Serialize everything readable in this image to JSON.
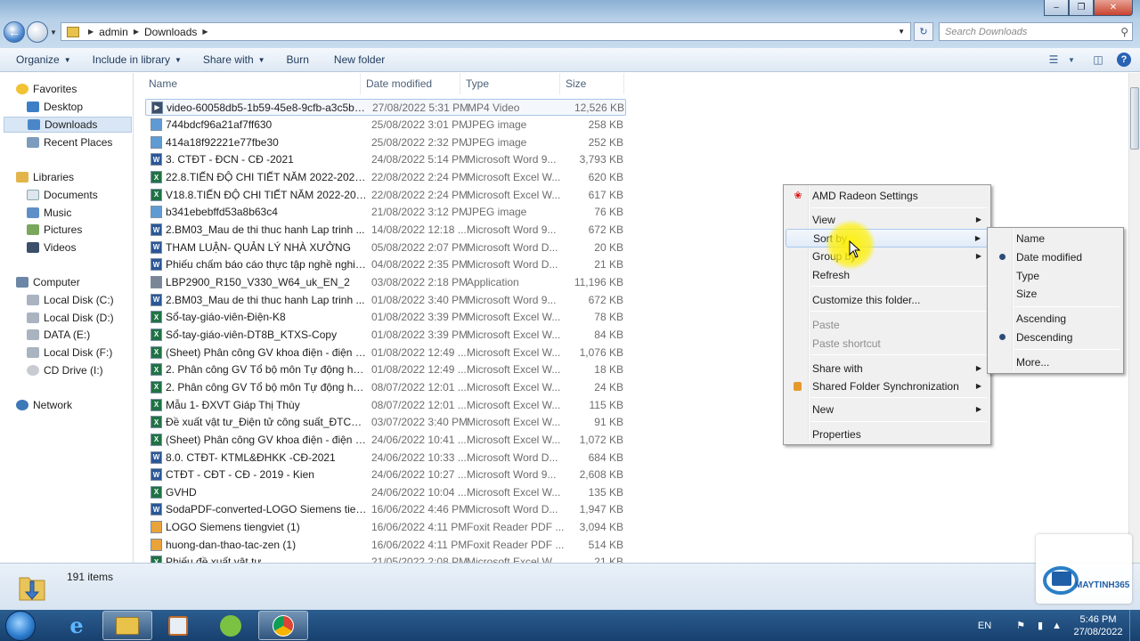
{
  "address": {
    "crumbs": [
      "admin",
      "Downloads"
    ]
  },
  "search": {
    "placeholder": "Search Downloads"
  },
  "toolbar": {
    "organize": "Organize",
    "include_in_library": "Include in library",
    "share_with": "Share with",
    "burn": "Burn",
    "new_folder": "New folder"
  },
  "nav": {
    "favorites": "Favorites",
    "desktop": "Desktop",
    "downloads": "Downloads",
    "recent_places": "Recent Places",
    "libraries": "Libraries",
    "documents": "Documents",
    "music": "Music",
    "pictures": "Pictures",
    "videos": "Videos",
    "computer": "Computer",
    "local_c": "Local Disk (C:)",
    "local_d": "Local Disk (D:)",
    "data_e": "DATA (E:)",
    "local_f": "Local Disk (F:)",
    "cd_i": "CD Drive (I:)",
    "network": "Network"
  },
  "columns": {
    "name": "Name",
    "date": "Date modified",
    "type": "Type",
    "size": "Size"
  },
  "files": [
    {
      "name": "video-60058db5-1b59-45e8-9cfb-a3c5b0...",
      "date": "27/08/2022 5:31 PM",
      "type": "MP4 Video",
      "size": "12,526 KB",
      "icon": "video"
    },
    {
      "name": "744bdcf96a21af7ff630",
      "date": "25/08/2022 3:01 PM",
      "type": "JPEG image",
      "size": "258 KB",
      "icon": "image"
    },
    {
      "name": "414a18f92221e77fbe30",
      "date": "25/08/2022 2:32 PM",
      "type": "JPEG image",
      "size": "252 KB",
      "icon": "image"
    },
    {
      "name": "3. CTĐT - ĐCN - CĐ -2021",
      "date": "24/08/2022 5:14 PM",
      "type": "Microsoft Word 9...",
      "size": "3,793 KB",
      "icon": "word"
    },
    {
      "name": "22.8.TIẾN ĐỘ CHI TIẾT NĂM 2022-2023 V...",
      "date": "22/08/2022 2:24 PM",
      "type": "Microsoft Excel W...",
      "size": "620 KB",
      "icon": "excel"
    },
    {
      "name": "V18.8.TIẾN ĐỘ CHI TIẾT NĂM 2022-2023 ...",
      "date": "22/08/2022 2:24 PM",
      "type": "Microsoft Excel W...",
      "size": "617 KB",
      "icon": "excel"
    },
    {
      "name": "b341ebebffd53a8b63c4",
      "date": "21/08/2022 3:12 PM",
      "type": "JPEG image",
      "size": "76 KB",
      "icon": "image"
    },
    {
      "name": "2.BM03_Mau de thi thuc hanh Lap trinh ...",
      "date": "14/08/2022 12:18 ...",
      "type": "Microsoft Word 9...",
      "size": "672 KB",
      "icon": "word"
    },
    {
      "name": "THAM LUẬN- QUẢN LÝ NHÀ XƯỞNG",
      "date": "05/08/2022 2:07 PM",
      "type": "Microsoft Word D...",
      "size": "20 KB",
      "icon": "word"
    },
    {
      "name": "Phiếu chấm báo cáo thực tập nghề nghiệp",
      "date": "04/08/2022 2:35 PM",
      "type": "Microsoft Word D...",
      "size": "21 KB",
      "icon": "word"
    },
    {
      "name": "LBP2900_R150_V330_W64_uk_EN_2",
      "date": "03/08/2022 2:18 PM",
      "type": "Application",
      "size": "11,196 KB",
      "icon": "app"
    },
    {
      "name": "2.BM03_Mau de thi thuc hanh Lap trinh ...",
      "date": "01/08/2022 3:40 PM",
      "type": "Microsoft Word 9...",
      "size": "672 KB",
      "icon": "word"
    },
    {
      "name": "Sổ-tay-giáo-viên-Điện-K8",
      "date": "01/08/2022 3:39 PM",
      "type": "Microsoft Excel W...",
      "size": "78 KB",
      "icon": "excel"
    },
    {
      "name": "Sổ-tay-giáo-viên-DT8B_KTXS-Copy",
      "date": "01/08/2022 3:39 PM",
      "type": "Microsoft Excel W...",
      "size": "84 KB",
      "icon": "excel"
    },
    {
      "name": "(Sheet) Phân công GV khoa điện - điện t...",
      "date": "01/08/2022 12:49 ...",
      "type": "Microsoft Excel W...",
      "size": "1,076 KB",
      "icon": "excel"
    },
    {
      "name": "2. Phân công GV Tổ bộ môn Tự động ho...",
      "date": "01/08/2022 12:49 ...",
      "type": "Microsoft Excel W...",
      "size": "18 KB",
      "icon": "excel"
    },
    {
      "name": "2. Phân công GV Tổ bộ môn Tự động ho...",
      "date": "08/07/2022 12:01 ...",
      "type": "Microsoft Excel W...",
      "size": "24 KB",
      "icon": "excel"
    },
    {
      "name": "Mẫu 1- ĐXVT Giáp Thị Thùy",
      "date": "08/07/2022 12:01 ...",
      "type": "Microsoft Excel W...",
      "size": "115 KB",
      "icon": "excel"
    },
    {
      "name": "Đề xuất vật tư_Điện tử công suất_ĐTCN_...",
      "date": "03/07/2022 3:40 PM",
      "type": "Microsoft Excel W...",
      "size": "91 KB",
      "icon": "excel"
    },
    {
      "name": "(Sheet) Phân công GV khoa điện - điện t...",
      "date": "24/06/2022 10:41 ...",
      "type": "Microsoft Excel W...",
      "size": "1,072 KB",
      "icon": "excel"
    },
    {
      "name": "8.0. CTĐT- KTML&ĐHKK -CĐ-2021",
      "date": "24/06/2022 10:33 ...",
      "type": "Microsoft Word D...",
      "size": "684 KB",
      "icon": "word"
    },
    {
      "name": "CTĐT - CĐT - CĐ - 2019 - Kien",
      "date": "24/06/2022 10:27 ...",
      "type": "Microsoft Word 9...",
      "size": "2,608 KB",
      "icon": "word"
    },
    {
      "name": "GVHD",
      "date": "24/06/2022 10:04 ...",
      "type": "Microsoft Excel W...",
      "size": "135 KB",
      "icon": "excel"
    },
    {
      "name": "SodaPDF-converted-LOGO Siemens tien...",
      "date": "16/06/2022 4:46 PM",
      "type": "Microsoft Word D...",
      "size": "1,947 KB",
      "icon": "word"
    },
    {
      "name": "LOGO Siemens tiengviet (1)",
      "date": "16/06/2022 4:11 PM",
      "type": "Foxit Reader PDF ...",
      "size": "3,094 KB",
      "icon": "pdf"
    },
    {
      "name": "huong-dan-thao-tac-zen (1)",
      "date": "16/06/2022 4:11 PM",
      "type": "Foxit Reader PDF ...",
      "size": "514 KB",
      "icon": "pdf"
    },
    {
      "name": "Phiếu đề xuất vật tư",
      "date": "21/05/2022 2:08 PM",
      "type": "Microsoft Excel W...",
      "size": "21 KB",
      "icon": "excel"
    }
  ],
  "context_menu": {
    "amd": "AMD Radeon Settings",
    "view": "View",
    "sort_by": "Sort by",
    "group_by": "Group by",
    "refresh": "Refresh",
    "customize": "Customize this folder...",
    "paste": "Paste",
    "paste_shortcut": "Paste shortcut",
    "share_with": "Share with",
    "shared_sync": "Shared Folder Synchronization",
    "new": "New",
    "properties": "Properties"
  },
  "sort_submenu": {
    "name": "Name",
    "date_modified": "Date modified",
    "type": "Type",
    "size": "Size",
    "ascending": "Ascending",
    "descending": "Descending",
    "more": "More...",
    "selected_field": "Date modified",
    "selected_order": "Descending"
  },
  "status": {
    "item_count": "191 items"
  },
  "taskbar": {
    "language": "EN",
    "time": "5:46 PM",
    "date": "27/08/2022"
  },
  "watermark": {
    "brand": "MAYTINH365"
  },
  "colors": {
    "selection": "#d8e6f5",
    "menu_bg": "#f0f0f0",
    "taskbar": "#1e4b7c",
    "cursor_highlight": "#fff000"
  }
}
